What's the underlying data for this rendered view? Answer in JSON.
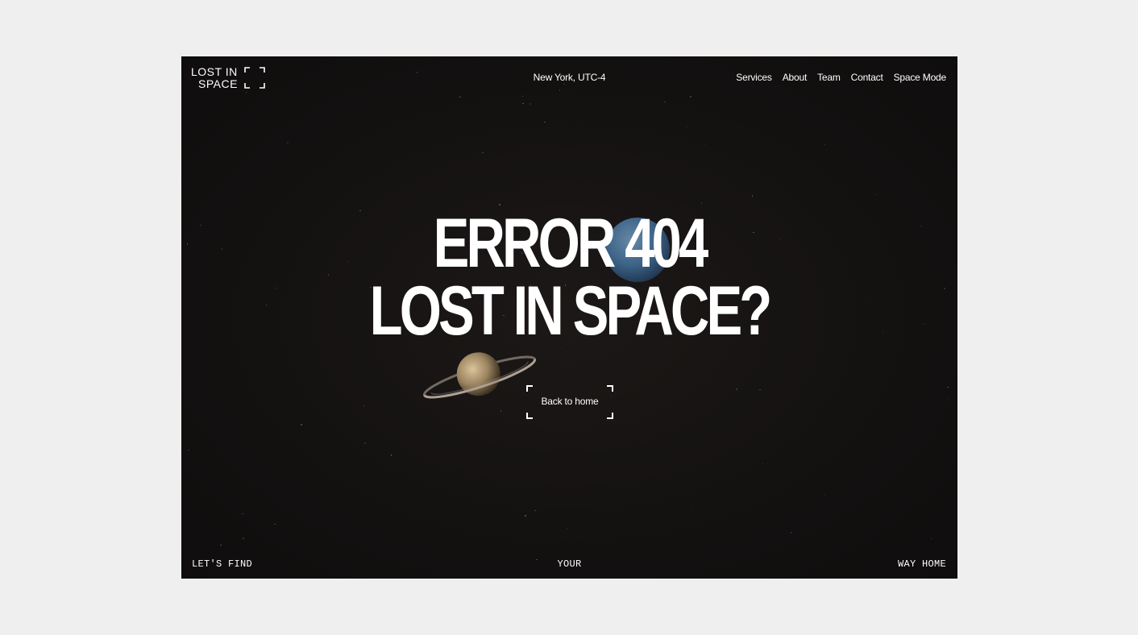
{
  "logo": {
    "line1": "LOST IN",
    "line2": "SPACE"
  },
  "header": {
    "location": "New York, UTC-4"
  },
  "nav": {
    "items": [
      {
        "label": "Services"
      },
      {
        "label": "About"
      },
      {
        "label": "Team"
      },
      {
        "label": "Contact"
      },
      {
        "label": "Space Mode"
      }
    ]
  },
  "hero": {
    "line1": "ERROR 404",
    "line2": "LOST IN SPACE?",
    "cta_label": "Back to home"
  },
  "footer": {
    "left": "LET'S FIND",
    "center": "YOUR",
    "right": "WAY HOME"
  },
  "colors": {
    "page_background": "#efefef",
    "frame_background": "#141211",
    "text": "#ffffff"
  }
}
